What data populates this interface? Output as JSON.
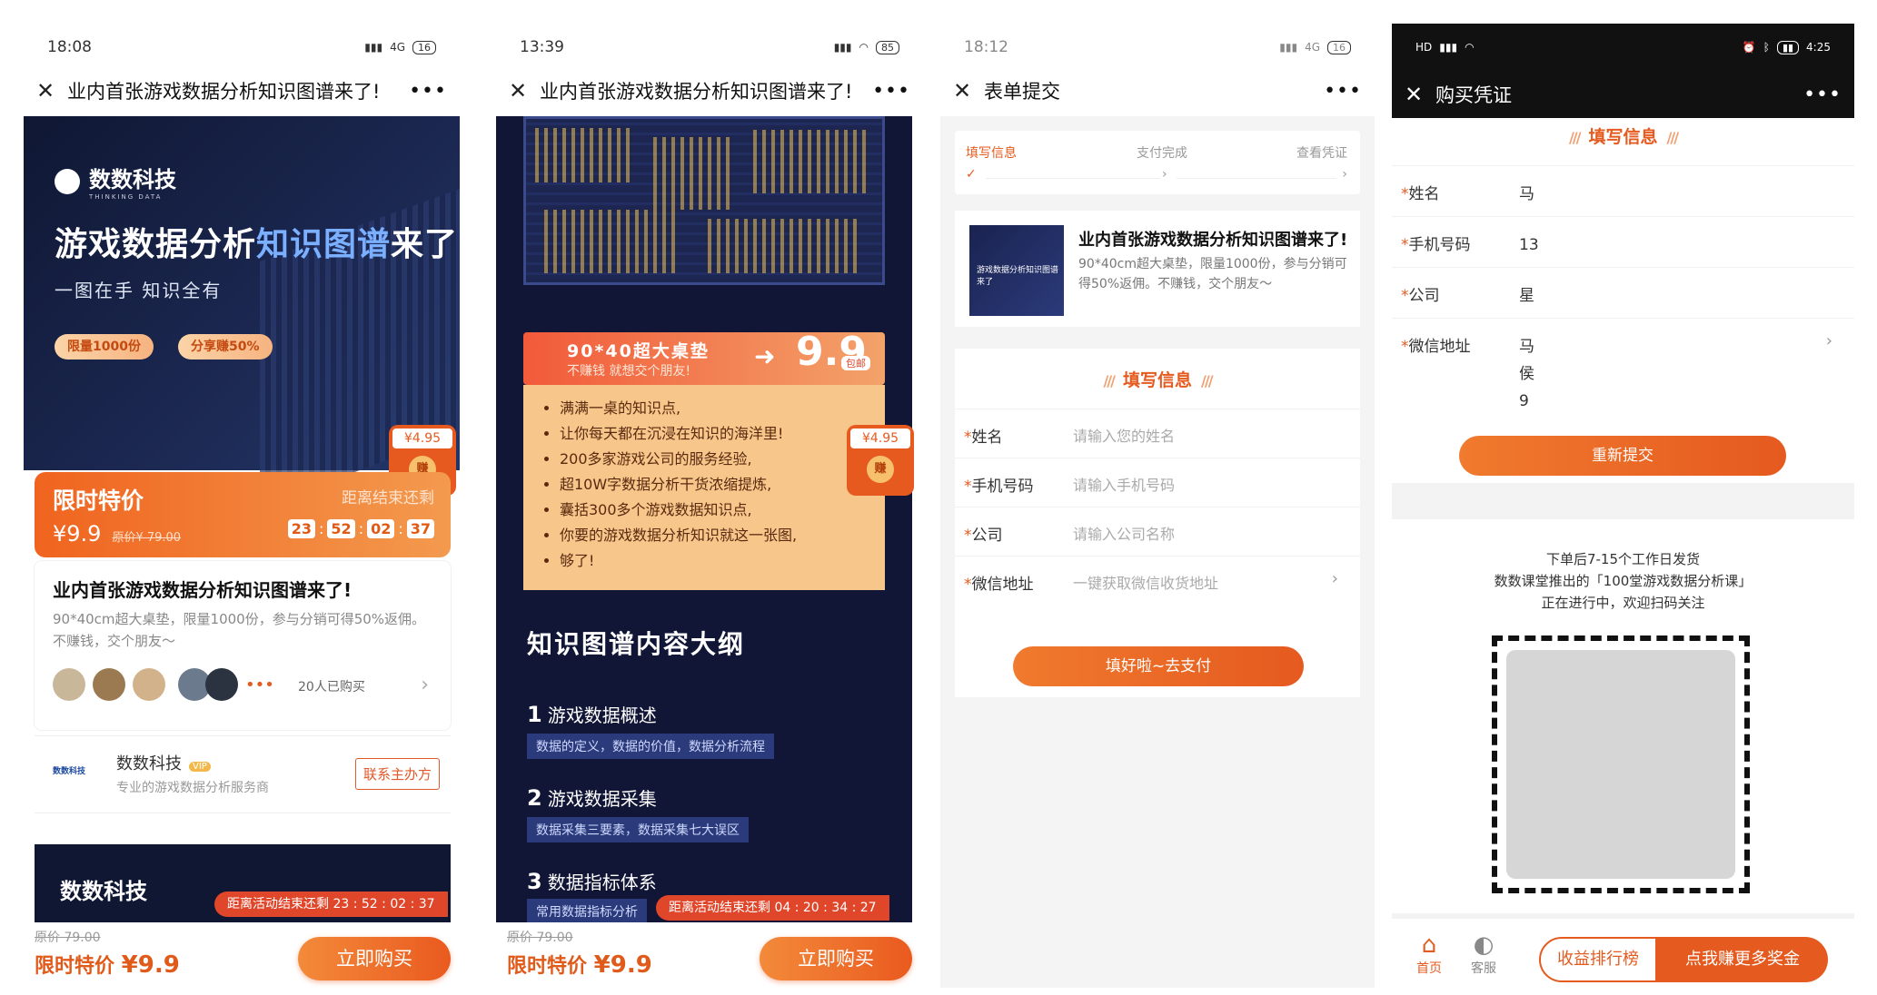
{
  "p1": {
    "time": "18:08",
    "signal": "4G",
    "battery": "16",
    "title": "业内首张游戏数据分析知识图谱来了!",
    "brand": "数数科技",
    "brand_sub": "THINKING DATA",
    "hero_title_a": "游戏数据分析",
    "hero_title_b": "知识图谱",
    "hero_title_c": "来了",
    "hero_sub": "一图在手 知识全有",
    "pill1": "限量1000份",
    "pill2": "分享赚50%",
    "packet_price": "¥4.95",
    "packet_coin": "赚",
    "promo_label": "限时特价",
    "promo_price": "¥9.9",
    "promo_orig_label": "原价",
    "promo_orig": "¥ 79.00",
    "countdown_label": "距离结束还剩",
    "countdown": [
      "23",
      "52",
      "02",
      "37"
    ],
    "product_title": "业内首张游戏数据分析知识图谱来了!",
    "product_desc": "90*40cm超大桌垫，限量1000份，参与分销可得50%返佣。不赚钱，交个朋友～",
    "buyers": "20人已购买",
    "store_name": "数数科技",
    "store_vip": "VIP",
    "store_desc": "专业的游戏数据分析服务商",
    "contact": "联系主办方",
    "banner_brand": "数数科技",
    "banner_cd": "距离活动结束还剩 23 : 52 : 02 : 37",
    "bottom_orig_label": "原价",
    "bottom_orig": "79.00",
    "bottom_label": "限时特价 ",
    "bottom_price": "¥9.9",
    "buy": "立即购买"
  },
  "p2": {
    "time": "13:39",
    "battery": "85",
    "title": "业内首张游戏数据分析知识图谱来了!",
    "ribbon_a": "90*40超大桌垫",
    "ribbon_b": "不赚钱 就想交个朋友!",
    "ribbon_price": "9.9",
    "ribbon_unit": "包邮",
    "packet_price": "¥4.95",
    "packet_coin": "赚",
    "bullets": [
      "满满一桌的知识点,",
      "让你每天都在沉浸在知识的海洋里!",
      "200多家游戏公司的服务经验,",
      "超10W字数据分析干货浓缩提炼,",
      "囊括300多个游戏数据知识点,",
      "你要的游戏数据分析知识就这一张图,",
      "够了!"
    ],
    "outline": "知识图谱内容大纲",
    "sections": [
      {
        "num": "1",
        "title": "游戏数据概述",
        "tag": "数据的定义，数据的价值，数据分析流程"
      },
      {
        "num": "2",
        "title": "游戏数据采集",
        "tag": "数据采集三要素，数据采集七大误区"
      },
      {
        "num": "3",
        "title": "数据指标体系",
        "tag": "常用数据指标分析"
      }
    ],
    "banner_cd": "距离活动结束还剩 04 : 20 : 34 : 27",
    "bottom_orig_label": "原价",
    "bottom_orig": "79.00",
    "bottom_label": "限时特价 ",
    "bottom_price": "¥9.9",
    "buy": "立即购买"
  },
  "p3": {
    "time": "18:12",
    "signal": "4G",
    "battery": "16",
    "title": "表单提交",
    "steps": [
      "填写信息",
      "支付完成",
      "查看凭证"
    ],
    "product_title": "业内首张游戏数据分析知识图谱来了!",
    "product_desc": "90*40cm超大桌垫，限量1000份，参与分销可得50%返佣。不赚钱，交个朋友～",
    "thumb_text": "游戏数据分析知识图谱来了",
    "form_title": "填写信息",
    "fields": [
      {
        "label": "姓名",
        "placeholder": "请输入您的姓名"
      },
      {
        "label": "手机号码",
        "placeholder": "请输入手机号码"
      },
      {
        "label": "公司",
        "placeholder": "请输入公司名称"
      },
      {
        "label": "微信地址",
        "placeholder": "一键获取微信收货地址"
      }
    ],
    "pay": "填好啦~去支付"
  },
  "p4": {
    "time": "4:25",
    "title": "购买凭证",
    "form_title": "填写信息",
    "fields": [
      {
        "label": "姓名",
        "value": "马"
      },
      {
        "label": "手机号码",
        "value": "13"
      },
      {
        "label": "公司",
        "value": "星"
      },
      {
        "label": "微信地址",
        "value": "马 侯 9"
      }
    ],
    "resubmit": "重新提交",
    "note1": "下单后7-15个工作日发货",
    "note2": "数数课堂推出的「100堂游戏数据分析课」",
    "note3": "正在进行中，欢迎扫码关注",
    "tab_home": "首页",
    "tab_service": "客服",
    "rank": "收益排行榜",
    "earn": "点我赚更多奖金"
  },
  "colors": {
    "accent": "#e55a1f",
    "dark_bg": "#111636",
    "promo": "#f0641f"
  }
}
